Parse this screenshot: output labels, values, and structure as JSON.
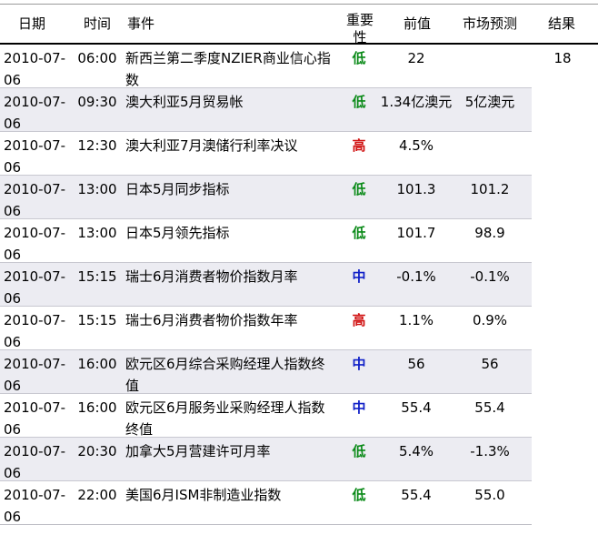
{
  "header": {
    "date": "日期",
    "time": "时间",
    "event": "事件",
    "importance": "重要性",
    "previous": "前值",
    "forecast": "市场预测",
    "result": "结果"
  },
  "colors": {
    "low": "#0a8a18",
    "high": "#d01010",
    "medium": "#1020c8"
  },
  "rows": [
    {
      "date_a": "2010-07-",
      "date_b": "06",
      "time": "06:00",
      "event": "新西兰第二季度NZIER商业信心指数",
      "importance": "低",
      "level": "low",
      "previous": "22",
      "forecast": "",
      "result": "18"
    },
    {
      "date_a": "2010-07-",
      "date_b": "06",
      "time": "09:30",
      "event": "澳大利亚5月贸易帐",
      "importance": "低",
      "level": "low",
      "previous": "1.34亿澳元",
      "forecast": "5亿澳元",
      "result": ""
    },
    {
      "date_a": "2010-07-",
      "date_b": "06",
      "time": "12:30",
      "event": "澳大利亚7月澳储行利率决议",
      "importance": "高",
      "level": "high",
      "previous": "4.5%",
      "forecast": "",
      "result": ""
    },
    {
      "date_a": "2010-07-",
      "date_b": "06",
      "time": "13:00",
      "event": "日本5月同步指标",
      "importance": "低",
      "level": "low",
      "previous": "101.3",
      "forecast": "101.2",
      "result": ""
    },
    {
      "date_a": "2010-07-",
      "date_b": "06",
      "time": "13:00",
      "event": "日本5月领先指标",
      "importance": "低",
      "level": "low",
      "previous": "101.7",
      "forecast": "98.9",
      "result": ""
    },
    {
      "date_a": "2010-07-",
      "date_b": "06",
      "time": "15:15",
      "event": "瑞士6月消费者物价指数月率",
      "importance": "中",
      "level": "mid",
      "previous": "-0.1%",
      "forecast": "-0.1%",
      "result": ""
    },
    {
      "date_a": "2010-07-",
      "date_b": "06",
      "time": "15:15",
      "event": "瑞士6月消费者物价指数年率",
      "importance": "高",
      "level": "high",
      "previous": "1.1%",
      "forecast": "0.9%",
      "result": ""
    },
    {
      "date_a": "2010-07-",
      "date_b": "06",
      "time": "16:00",
      "event": "欧元区6月综合采购经理人指数终值",
      "importance": "中",
      "level": "mid",
      "previous": "56",
      "forecast": "56",
      "result": ""
    },
    {
      "date_a": "2010-07-",
      "date_b": "06",
      "time": "16:00",
      "event": "欧元区6月服务业采购经理人指数终值",
      "importance": "中",
      "level": "mid",
      "previous": "55.4",
      "forecast": "55.4",
      "result": ""
    },
    {
      "date_a": "2010-07-",
      "date_b": "06",
      "time": "20:30",
      "event": "加拿大5月营建许可月率",
      "importance": "低",
      "level": "low",
      "previous": "5.4%",
      "forecast": "-1.3%",
      "result": ""
    },
    {
      "date_a": "2010-07-",
      "date_b": "06",
      "time": "22:00",
      "event": "美国6月ISM非制造业指数",
      "importance": "低",
      "level": "low",
      "previous": "55.4",
      "forecast": "55.0",
      "result": ""
    }
  ]
}
